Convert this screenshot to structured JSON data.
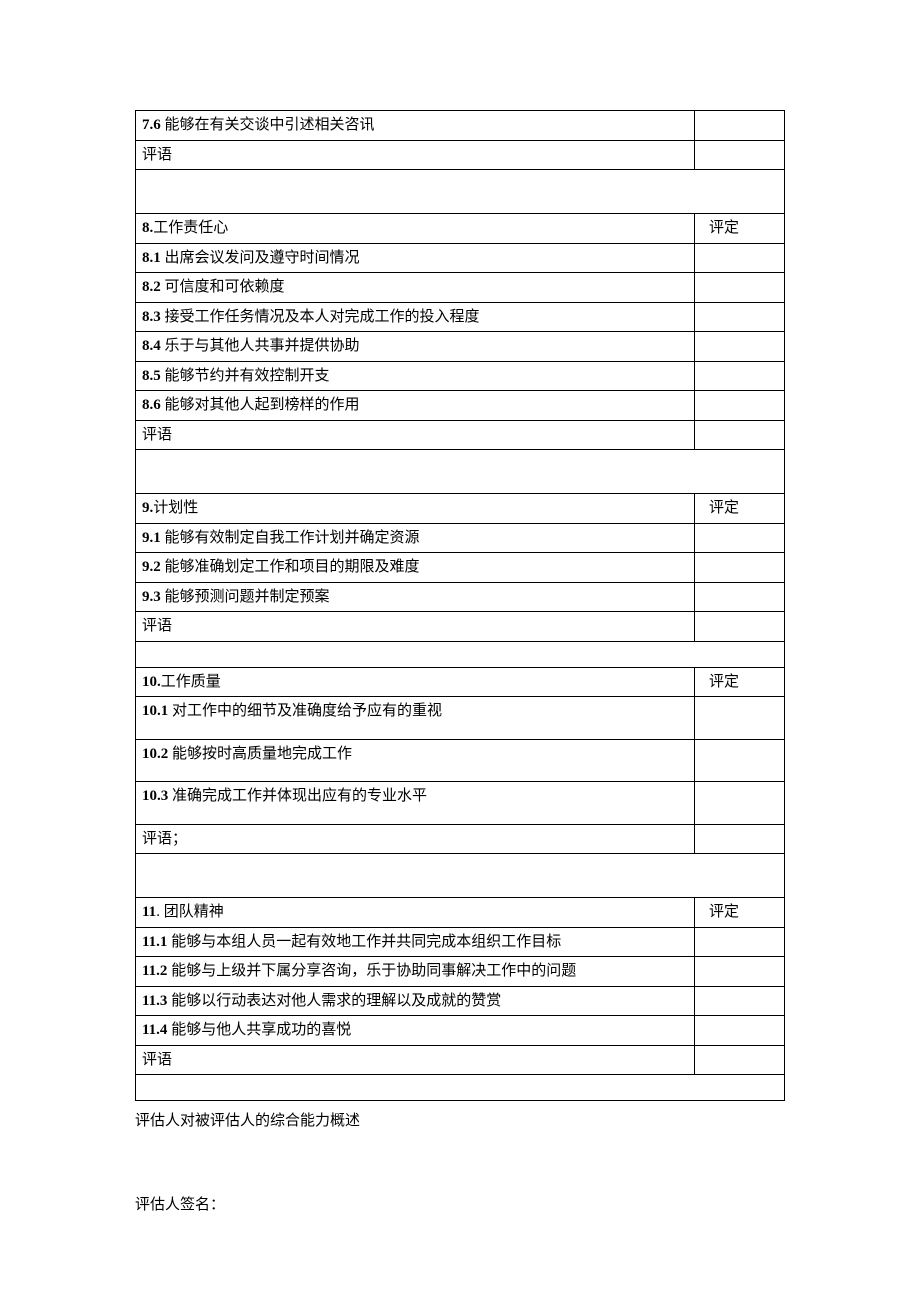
{
  "labels": {
    "rating": "评定",
    "comment": "评语",
    "comment_colon": "评语；"
  },
  "section7": {
    "item6": {
      "num": "7.6",
      "text": " 能够在有关交谈中引述相关咨讯"
    }
  },
  "section8": {
    "title": {
      "num": "8.",
      "text": "工作责任心"
    },
    "items": [
      {
        "num": "8.1",
        "text": " 出席会议发问及遵守时间情况"
      },
      {
        "num": "8.2",
        "text": " 可信度和可依赖度"
      },
      {
        "num": "8.3",
        "text": " 接受工作任务情况及本人对完成工作的投入程度"
      },
      {
        "num": "8.4",
        "text": " 乐于与其他人共事并提供协助"
      },
      {
        "num": "8.5",
        "text": " 能够节约并有效控制开支"
      },
      {
        "num": "8.6",
        "text": " 能够对其他人起到榜样的作用"
      }
    ]
  },
  "section9": {
    "title": {
      "num": "9.",
      "text": "计划性"
    },
    "items": [
      {
        "num": "9.1",
        "text": " 能够有效制定自我工作计划并确定资源"
      },
      {
        "num": "9.2",
        "text": " 能够准确划定工作和项目的期限及难度"
      },
      {
        "num": "9.3",
        "text": " 能够预测问题并制定预案"
      }
    ]
  },
  "section10": {
    "title": {
      "num": "10.",
      "text": "工作质量"
    },
    "items": [
      {
        "num": "10.1",
        "text": " 对工作中的细节及准确度给予应有的重视"
      },
      {
        "num": "10.2",
        "text": " 能够按时高质量地完成工作"
      },
      {
        "num": "10.3",
        "text": " 准确完成工作并体现出应有的专业水平"
      }
    ]
  },
  "section11": {
    "title": {
      "num": "11",
      "text": ". 团队精神"
    },
    "items": [
      {
        "num": "11.1",
        "text": " 能够与本组人员一起有效地工作并共同完成本组织工作目标"
      },
      {
        "num": "11.2",
        "text": " 能够与上级并下属分享咨询，乐于协助同事解决工作中的问题"
      },
      {
        "num": "11.3",
        "text": " 能够以行动表达对他人需求的理解以及成就的赞赏"
      },
      {
        "num": "11.4",
        "text": " 能够与他人共享成功的喜悦"
      }
    ]
  },
  "footer": {
    "summary_label": "评估人对被评估人的综合能力概述",
    "signature_label": "评估人签名："
  }
}
